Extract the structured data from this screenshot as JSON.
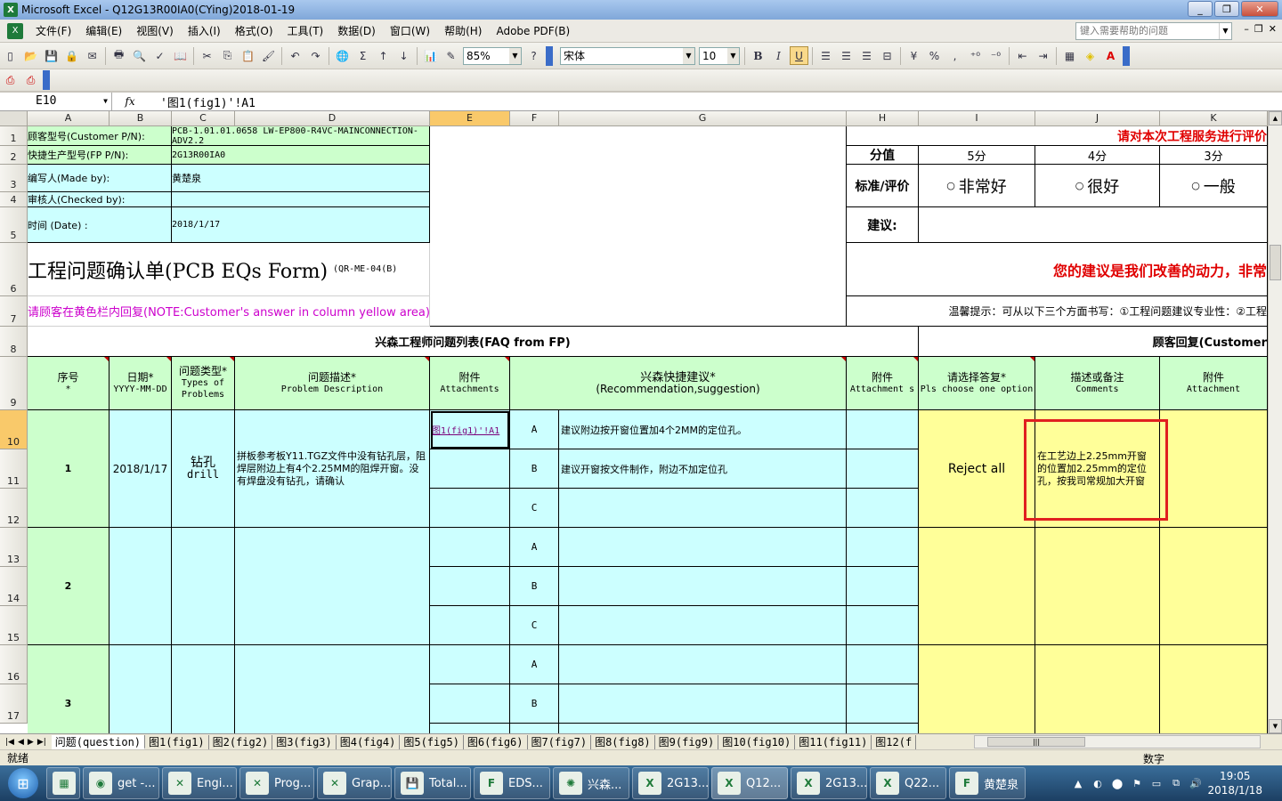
{
  "window": {
    "title": "Microsoft Excel - Q12G13R00IA0(CYing)2018-01-19",
    "min": "_",
    "restore": "❐",
    "close": "✕"
  },
  "menu": {
    "items": [
      "文件(F)",
      "编辑(E)",
      "视图(V)",
      "插入(I)",
      "格式(O)",
      "工具(T)",
      "数据(D)",
      "窗口(W)",
      "帮助(H)",
      "Adobe PDF(B)"
    ],
    "help_placeholder": "键入需要帮助的问题"
  },
  "toolbar": {
    "zoom": "85%",
    "font": "宋体",
    "font_size": "10",
    "bold": "B",
    "italic": "I",
    "underline": "U",
    "sum": "Σ",
    "percent": "%"
  },
  "formula_bar": {
    "name_box": "E10",
    "fx": "fx",
    "formula": "'图1(fig1)'!A1"
  },
  "columns": [
    "A",
    "B",
    "C",
    "D",
    "E",
    "F",
    "G",
    "H",
    "I",
    "J",
    "K"
  ],
  "rows": [
    "1",
    "2",
    "3",
    "4",
    "5",
    "6",
    "7",
    "8",
    "9",
    "10",
    "11",
    "12",
    "13",
    "14",
    "15",
    "16",
    "17"
  ],
  "header_info": {
    "cust_pn_label": "顾客型号(Customer P/N):",
    "cust_pn_value": "PCB-1.01.01.0658 LW-EP800-R4VC-MAINCONNECTION-ADV2.2",
    "fp_pn_label": "快捷生产型号(FP P/N):",
    "fp_pn_value": "2G13R00IA0",
    "made_by_label": "编写人(Made by):",
    "made_by_value": "黄楚泉",
    "checked_by_label": "审核人(Checked by):",
    "date_label": "时间 (Date) :",
    "date_value": "2018/1/17",
    "form_title": "工程问题确认单(PCB EQs Form)",
    "form_code": "(QR-ME-04(B)",
    "note": "请顾客在黄色栏内回复(NOTE:Customer's answer in column yellow area)"
  },
  "rating": {
    "banner": "请对本次工程服务进行评价",
    "score_label": "分值",
    "score_5": "5分",
    "score_4": "4分",
    "score_3": "3分",
    "std_label": "标准/评价",
    "opt_5": "非常好",
    "opt_4": "很好",
    "opt_3": "一般",
    "suggest_label": "建议:",
    "motto": "您的建议是我们改善的动力，非常",
    "tip": "温馨提示：可从以下三个方面书写：①工程问题建议专业性：②工程"
  },
  "table": {
    "fp_title": "兴森工程师问题列表(FAQ from FP)",
    "cust_title": "顾客回复(Customer",
    "h_no_cn": "序号",
    "h_no_en": "*",
    "h_date_cn": "日期*",
    "h_date_en": "YYYY-MM-DD",
    "h_type_cn": "问题类型*",
    "h_type_en": "Types of Problems",
    "h_desc_cn": "问题描述*",
    "h_desc_en": "Problem Description",
    "h_att_cn": "附件",
    "h_att_en": "Attachments",
    "h_rec_cn": "兴森快捷建议*",
    "h_rec_en": "(Recommendation,suggestion)",
    "h_att2_cn": "附件",
    "h_att2_en": "Attachment s",
    "h_choose_cn": "请选择答复*",
    "h_choose_en": "Pls choose one option",
    "h_cmt_cn": "描述或备注",
    "h_cmt_en": "Comments",
    "h_att3_cn": "附件",
    "h_att3_en": "Attachment"
  },
  "issues": [
    {
      "no": "1",
      "date": "2018/1/17",
      "type_cn": "钻孔",
      "type_en": "drill",
      "desc": "拼板参考板Y11.TGZ文件中没有钻孔层，阻焊层附边上有4个2.25MM的阻焊开窗。没有焊盘没有钻孔，请确认",
      "attachment": "图1(fig1)'!A1",
      "opts": [
        "A",
        "B",
        "C"
      ],
      "recs": [
        "建议附边按开窗位置加4个2MM的定位孔。",
        "建议开窗按文件制作，附边不加定位孔",
        ""
      ],
      "reply": "Reject all",
      "comment": "在工艺边上2.25mm开窗的位置加2.25mm的定位孔，按我司常规加大开窗"
    },
    {
      "no": "2",
      "opts": [
        "A",
        "B",
        "C"
      ]
    },
    {
      "no": "3",
      "opts": [
        "A",
        "B"
      ]
    }
  ],
  "sheet_tabs": [
    "问题(question)",
    "图1(fig1)",
    "图2(fig2)",
    "图3(fig3)",
    "图4(fig4)",
    "图5(fig5)",
    "图6(fig6)",
    "图7(fig7)",
    "图8(fig8)",
    "图9(fig9)",
    "图10(fig10)",
    "图11(fig11)",
    "图12(f"
  ],
  "status": {
    "ready": "就绪",
    "mode": "数字"
  },
  "taskbar": {
    "tasks": [
      "get -...",
      "Engi...",
      "Prog...",
      "Grap...",
      "Total...",
      "EDS...",
      "兴森...",
      "2G13...",
      "Q12...",
      "2G13...",
      "Q22...",
      "黄楚泉"
    ],
    "time": "19:05",
    "date": "2018/1/18"
  }
}
